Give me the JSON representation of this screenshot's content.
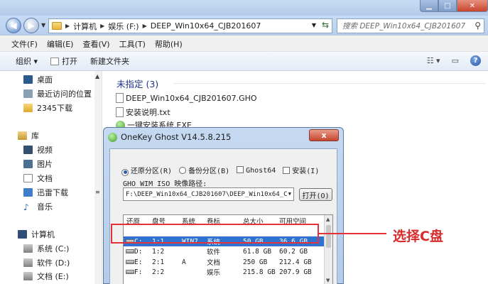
{
  "window": {
    "min": "▁",
    "max": "□",
    "close": "✕"
  },
  "nav": {
    "back": "◀",
    "forward": "▶",
    "breadcrumbs": [
      "计算机",
      "娱乐 (F:)",
      "DEEP_Win10x64_CJB201607"
    ],
    "search_placeholder": "搜索 DEEP_Win10x64_CJB201607"
  },
  "menu": [
    "文件(F)",
    "编辑(E)",
    "查看(V)",
    "工具(T)",
    "帮助(H)"
  ],
  "commands": {
    "organize": "组织 ▾",
    "open": "打开",
    "new_folder": "新建文件夹"
  },
  "sidebar": {
    "items": [
      "桌面",
      "最近访问的位置",
      "2345下载",
      "库",
      "视频",
      "图片",
      "文档",
      "迅雷下载",
      "音乐",
      "计算机",
      "系统 (C:)",
      "软件 (D:)",
      "文档 (E:)"
    ]
  },
  "files": {
    "group": "未指定 (3)",
    "items": [
      "DEEP_Win10x64_CJB201607.GHO",
      "安装说明.txt",
      "一键安装系统.EXE"
    ]
  },
  "dialog": {
    "title": "OneKey Ghost V14.5.8.215",
    "close": "x",
    "options": {
      "restore": "还原分区(R)",
      "backup": "备份分区(B)",
      "ghost64": "Ghost64",
      "install": "安装(I)"
    },
    "path_label": "GHO WIM ISO 映像路径:",
    "path_value": "F:\\DEEP_Win10x64_CJB201607\\DEEP_Win10x64_C",
    "open_btn": "打开(O)",
    "table": {
      "headers": [
        "还原",
        "盘号",
        "系统",
        "卷标",
        "总大小",
        "可用空间"
      ],
      "rows": [
        {
          "drive": "C:",
          "disk": "1:1",
          "sys": "WIN7",
          "label": "系统",
          "total": "50 GB",
          "free": "36.6 GB"
        },
        {
          "drive": "D:",
          "disk": "1:2",
          "sys": "",
          "label": "软件",
          "total": "61.8 GB",
          "free": "60.2 GB"
        },
        {
          "drive": "E:",
          "disk": "2:1",
          "sys": "A",
          "label": "文档",
          "total": "250 GB",
          "free": "212.4 GB"
        },
        {
          "drive": "F:",
          "disk": "2:2",
          "sys": "",
          "label": "娱乐",
          "total": "215.8 GB",
          "free": "207.9 GB"
        }
      ]
    }
  },
  "annotation": "选择C盘",
  "colors": {
    "highlight": "#e53238",
    "selection": "#3072d0"
  }
}
